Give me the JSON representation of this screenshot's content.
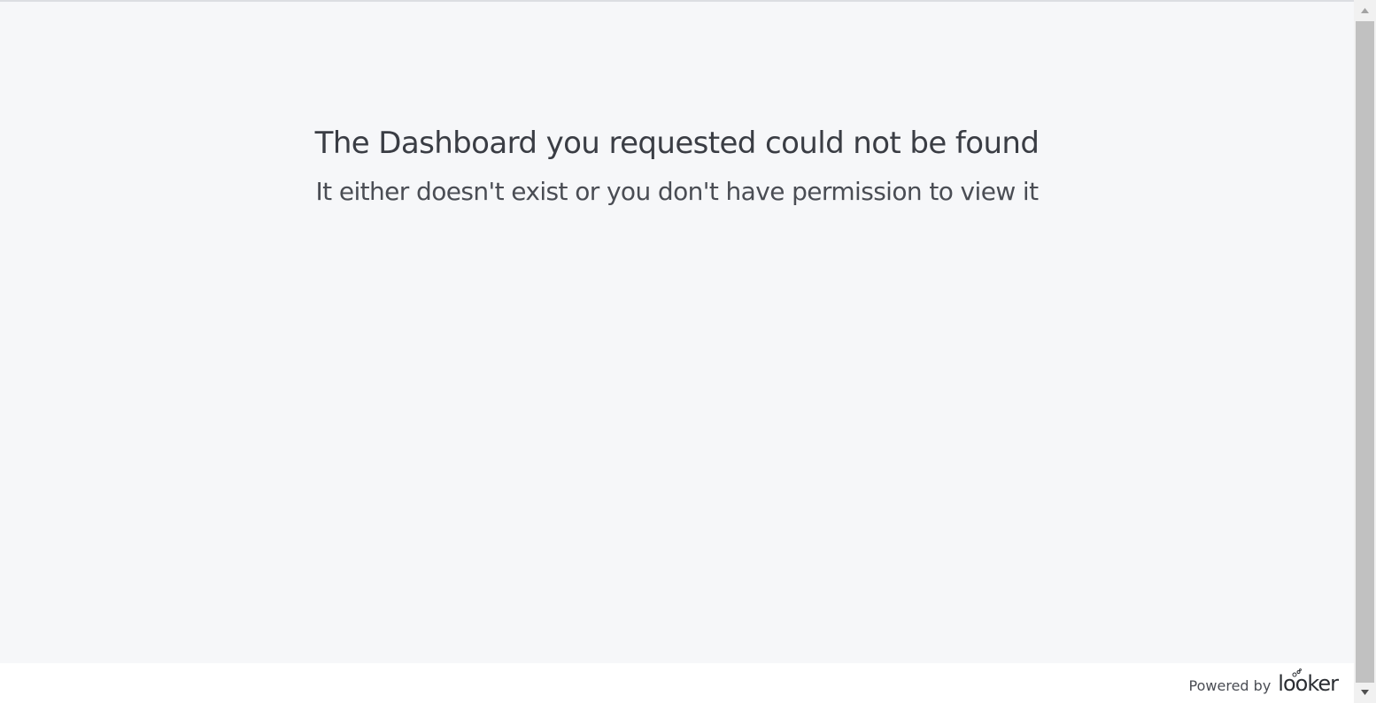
{
  "message": {
    "title": "The Dashboard you requested could not be found",
    "subtitle": "It either doesn't exist or you don't have permission to view it"
  },
  "footer": {
    "powered_by": "Powered by",
    "logo_text": "looker",
    "logo_icon": "looker-logo-icon"
  },
  "scrollbar": {
    "up_icon": "scroll-up-arrow-icon",
    "down_icon": "scroll-down-arrow-icon"
  },
  "colors": {
    "content_background": "#f6f7f9",
    "text": "#3a3d44",
    "scrollbar_thumb": "#c1c1c1"
  }
}
